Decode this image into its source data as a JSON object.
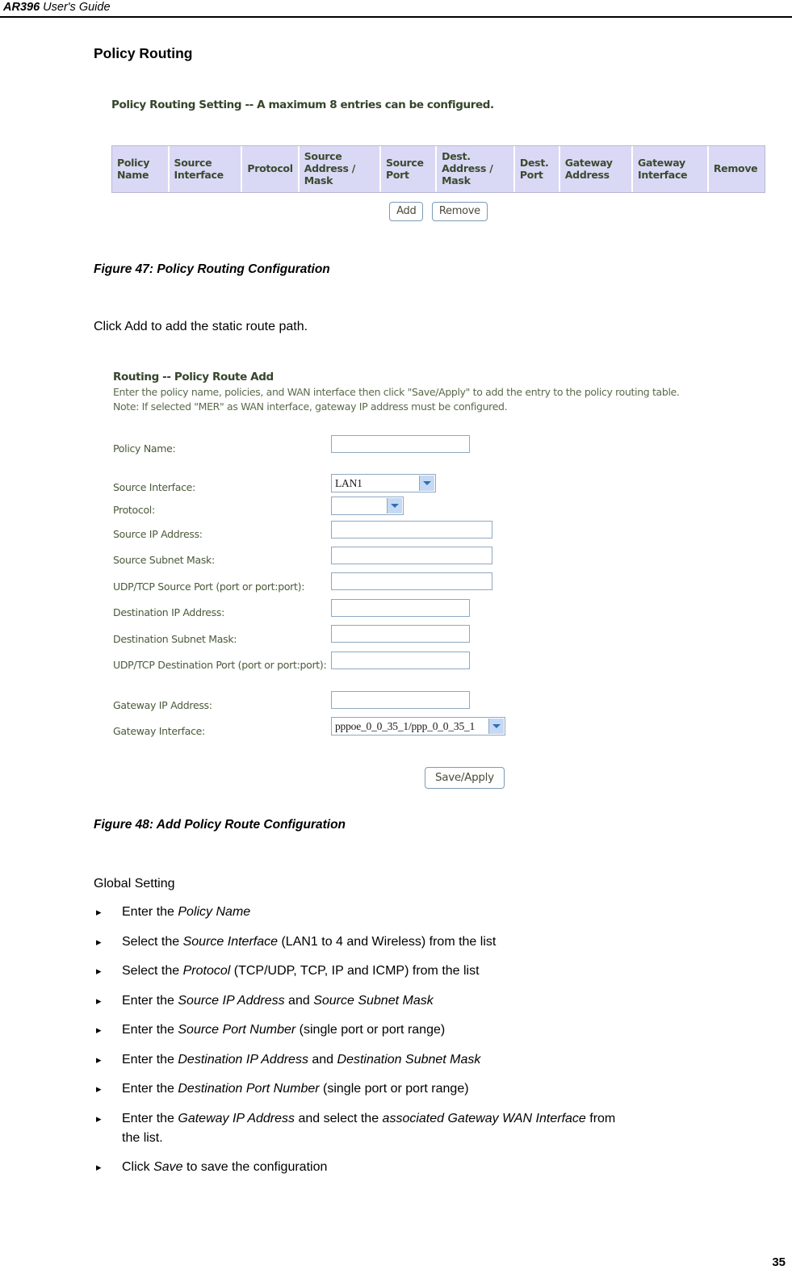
{
  "header": {
    "model": "AR396",
    "title": "User's Guide"
  },
  "page_number": "35",
  "section": {
    "heading": "Policy Routing"
  },
  "figure_47": {
    "caption": "Figure 47: Policy Routing Configuration",
    "screenshot": {
      "caption": "Policy Routing Setting -- A maximum 8 entries can be configured.",
      "table": {
        "columns": [
          "Policy Name",
          "Source Interface",
          "Protocol",
          "Source Address / Mask",
          "Source Port",
          "Dest. Address / Mask",
          "Dest. Port",
          "Gateway Address",
          "Gateway Interface",
          "Remove"
        ],
        "rows": []
      },
      "buttons": {
        "add": "Add",
        "remove": "Remove"
      },
      "colors": {
        "header_bg": "#d9d9f5",
        "header_text": "#3b4a30",
        "table_border": "#b8b8d8"
      }
    }
  },
  "body_text": {
    "click_add": "Click Add to add the static route path."
  },
  "figure_48": {
    "caption": "Figure 48: Add Policy Route Configuration",
    "screenshot": {
      "title": "Routing -- Policy Route Add",
      "description": "Enter the policy name, policies, and WAN interface then click \"Save/Apply\" to add the entry to the policy routing table.",
      "note": "Note: If selected \"MER\" as WAN interface, gateway IP address must be configured.",
      "fields": [
        {
          "label": "Policy Name:",
          "type": "text",
          "value": ""
        },
        {
          "label": "Source Interface:",
          "type": "select",
          "value": "LAN1"
        },
        {
          "label": "Protocol:",
          "type": "select",
          "value": ""
        },
        {
          "label": "Source IP Address:",
          "type": "text",
          "value": ""
        },
        {
          "label": "Source Subnet Mask:",
          "type": "text",
          "value": ""
        },
        {
          "label": "UDP/TCP Source Port (port or port:port):",
          "type": "text",
          "value": ""
        },
        {
          "label": "Destination IP Address:",
          "type": "text",
          "value": ""
        },
        {
          "label": "Destination Subnet Mask:",
          "type": "text",
          "value": ""
        },
        {
          "label": "UDP/TCP Destination Port (port or port:port):",
          "type": "text",
          "value": ""
        },
        {
          "label": "Gateway IP Address:",
          "type": "text",
          "value": ""
        },
        {
          "label": "Gateway Interface:",
          "type": "select",
          "value": "pppoe_0_0_35_1/ppp_0_0_35_1"
        }
      ],
      "save_button": "Save/Apply",
      "colors": {
        "field_border": "#8fa8bf",
        "select_arrow_bg": "#c5d9f5",
        "text": "#4a5a3a"
      }
    }
  },
  "global_setting": {
    "heading": "Global Setting",
    "bullet_marker": "▸",
    "bullets": [
      {
        "parts": [
          {
            "t": "Enter the ",
            "i": false
          },
          {
            "t": "Policy Name",
            "i": true
          }
        ]
      },
      {
        "parts": [
          {
            "t": "Select the ",
            "i": false
          },
          {
            "t": "Source Interface",
            "i": true
          },
          {
            "t": " (LAN1 to 4 and Wireless) from the list",
            "i": false
          }
        ]
      },
      {
        "parts": [
          {
            "t": "Select the ",
            "i": false
          },
          {
            "t": "Protocol",
            "i": true
          },
          {
            "t": " (TCP/UDP, TCP, IP and ICMP) from the list",
            "i": false
          }
        ]
      },
      {
        "parts": [
          {
            "t": "Enter the ",
            "i": false
          },
          {
            "t": "Source IP Address",
            "i": true
          },
          {
            "t": " and ",
            "i": false
          },
          {
            "t": "Source Subnet Mask",
            "i": true
          }
        ]
      },
      {
        "parts": [
          {
            "t": "Enter the ",
            "i": false
          },
          {
            "t": "Source Port Number",
            "i": true
          },
          {
            "t": " (single port or port range)",
            "i": false
          }
        ]
      },
      {
        "parts": [
          {
            "t": "Enter the ",
            "i": false
          },
          {
            "t": "Destination IP Address",
            "i": true
          },
          {
            "t": " and ",
            "i": false
          },
          {
            "t": "Destination Subnet Mask",
            "i": true
          }
        ]
      },
      {
        "parts": [
          {
            "t": "Enter the ",
            "i": false
          },
          {
            "t": "Destination Port Number",
            "i": true
          },
          {
            "t": " (single port or port range)",
            "i": false
          }
        ]
      },
      {
        "justify": true,
        "parts": [
          {
            "t": "Enter the ",
            "i": false
          },
          {
            "t": "Gateway IP Address",
            "i": true
          },
          {
            "t": " and select the ",
            "i": false
          },
          {
            "t": "associated Gateway WAN Interface",
            "i": true
          },
          {
            "t": " from",
            "i": false
          },
          {
            "t": "the list.",
            "i": false,
            "newline": true
          }
        ]
      },
      {
        "parts": [
          {
            "t": "Click ",
            "i": false
          },
          {
            "t": "Save",
            "i": true
          },
          {
            "t": " to save the configuration",
            "i": false
          }
        ]
      }
    ]
  }
}
